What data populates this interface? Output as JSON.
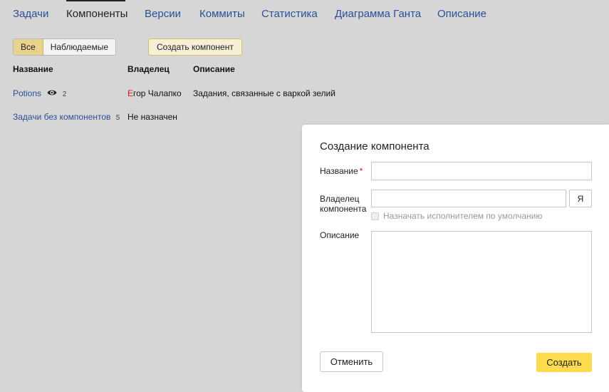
{
  "tabs": [
    {
      "label": "Задачи"
    },
    {
      "label": "Компоненты"
    },
    {
      "label": "Версии"
    },
    {
      "label": "Коммиты"
    },
    {
      "label": "Статистика"
    },
    {
      "label": "Диаграмма Ганта"
    },
    {
      "label": "Описание"
    }
  ],
  "active_tab": "Компоненты",
  "filter": {
    "all": "Все",
    "watched": "Наблюдаемые",
    "selected": "Все"
  },
  "create_component_label": "Создать компонент",
  "table": {
    "headers": {
      "name": "Название",
      "owner": "Владелец",
      "description": "Описание"
    },
    "rows": [
      {
        "name": "Potions",
        "icon": "eye-icon",
        "count": "2",
        "owner_first": "Е",
        "owner_rest": "гор Чалапко",
        "description": "Задания, связанные с варкой зелий"
      },
      {
        "name": "Задачи без компонентов",
        "count": "5",
        "owner": "Не назначен",
        "description": ""
      }
    ]
  },
  "modal": {
    "title": "Создание компонента",
    "name_label": "Название",
    "required_mark": "*",
    "name_value": "",
    "owner_label_1": "Владелец",
    "owner_label_2": "компонента",
    "owner_value": "",
    "me_button": "Я",
    "default_assignee_label": "Назначать исполнителем по умолчанию",
    "default_assignee_checked": false,
    "description_label": "Описание",
    "description_value": "",
    "cancel_label": "Отменить",
    "submit_label": "Создать"
  },
  "colors": {
    "link": "#2b4f96",
    "accent_yellow": "#ffdb4d",
    "segment_active": "#e8d38c",
    "backdrop": "#d6d6d6"
  }
}
